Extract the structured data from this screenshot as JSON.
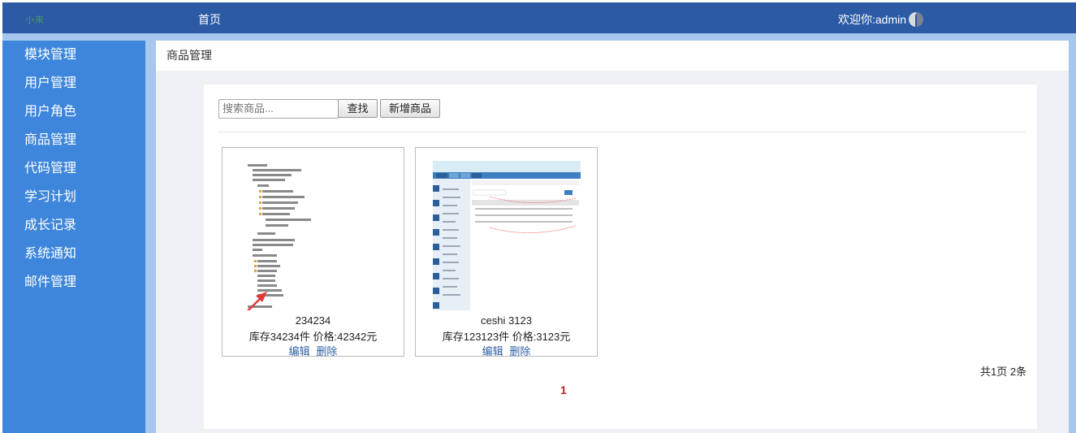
{
  "header": {
    "logo_text": "小来",
    "home_label": "首页",
    "welcome_text": "欢迎你:admin"
  },
  "sidebar": {
    "items": [
      {
        "label": "模块管理"
      },
      {
        "label": "用户管理"
      },
      {
        "label": "用户角色"
      },
      {
        "label": "商品管理"
      },
      {
        "label": "代码管理"
      },
      {
        "label": "学习计划"
      },
      {
        "label": "成长记录"
      },
      {
        "label": "系统通知"
      },
      {
        "label": "邮件管理"
      }
    ]
  },
  "breadcrumb": {
    "title": "商品管理"
  },
  "toolbar": {
    "search_placeholder": "搜索商品...",
    "find_label": "查找",
    "add_label": "新增商品"
  },
  "products": [
    {
      "name": "234234",
      "info": "库存34234件  价格:42342元",
      "edit_label": "编辑",
      "delete_label": "删除"
    },
    {
      "name": "ceshi 3123",
      "info": "库存123123件  价格:3123元",
      "edit_label": "编辑",
      "delete_label": "删除"
    }
  ],
  "pagination": {
    "total_text": "共1页 2条",
    "current_page": "1"
  },
  "colors": {
    "header_bg": "#2c5aa5",
    "sidebar_bg": "#3d86db",
    "accent_light": "#a6c8ef",
    "link": "#2f5fa5",
    "page_current": "#b32020"
  }
}
